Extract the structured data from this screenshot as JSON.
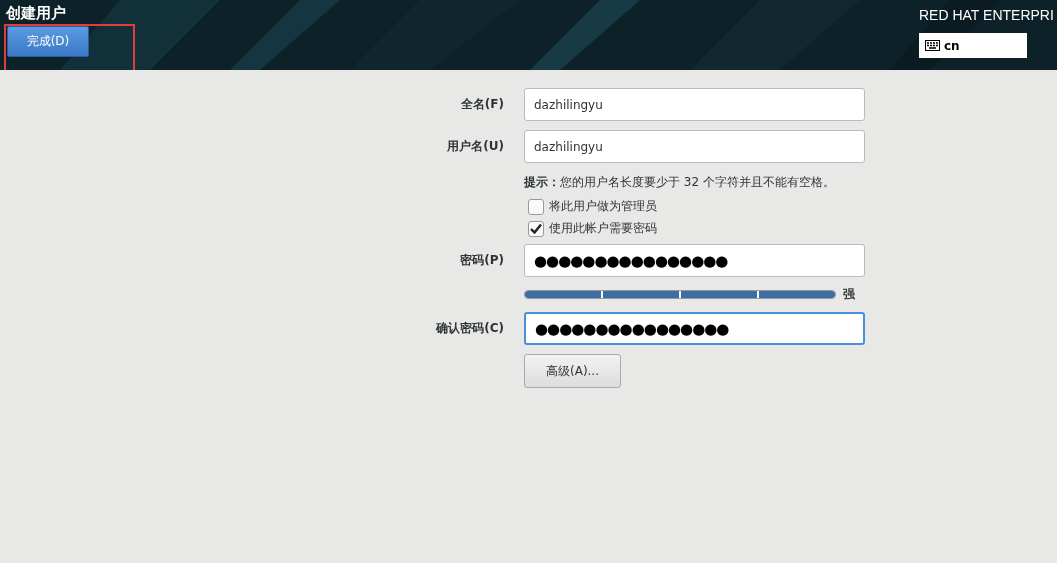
{
  "header": {
    "title": "创建用户",
    "done_button": "完成(D)",
    "product": "RED HAT ENTERPRI",
    "keyboard_layout": "cn"
  },
  "annotations": [
    {
      "kind": "rectangle",
      "color": "#e03c3c"
    }
  ],
  "form": {
    "full_name": {
      "label": "全名(F)",
      "value": "dazhilingyu",
      "focused": false
    },
    "username": {
      "label": "用户名(U)",
      "value": "dazhilingyu",
      "focused": false
    },
    "hint": "**提示：**您的用户名长度要少于 32 个字符并且不能有空格。",
    "options": [
      {
        "label": "将此用户做为管理员",
        "checked": false
      },
      {
        "label": "使用此帐户需要密码",
        "checked": true
      }
    ],
    "password": {
      "label": "密码(P)",
      "value": "●●●●●●●●●●●●●●●●",
      "focused": false
    },
    "strength": {
      "level": 1,
      "label": "强"
    },
    "confirm": {
      "label": "确认密码(C)",
      "value": "●●●●●●●●●●●●●●●●",
      "focused": true
    },
    "advanced_button": "高级(A)..."
  }
}
